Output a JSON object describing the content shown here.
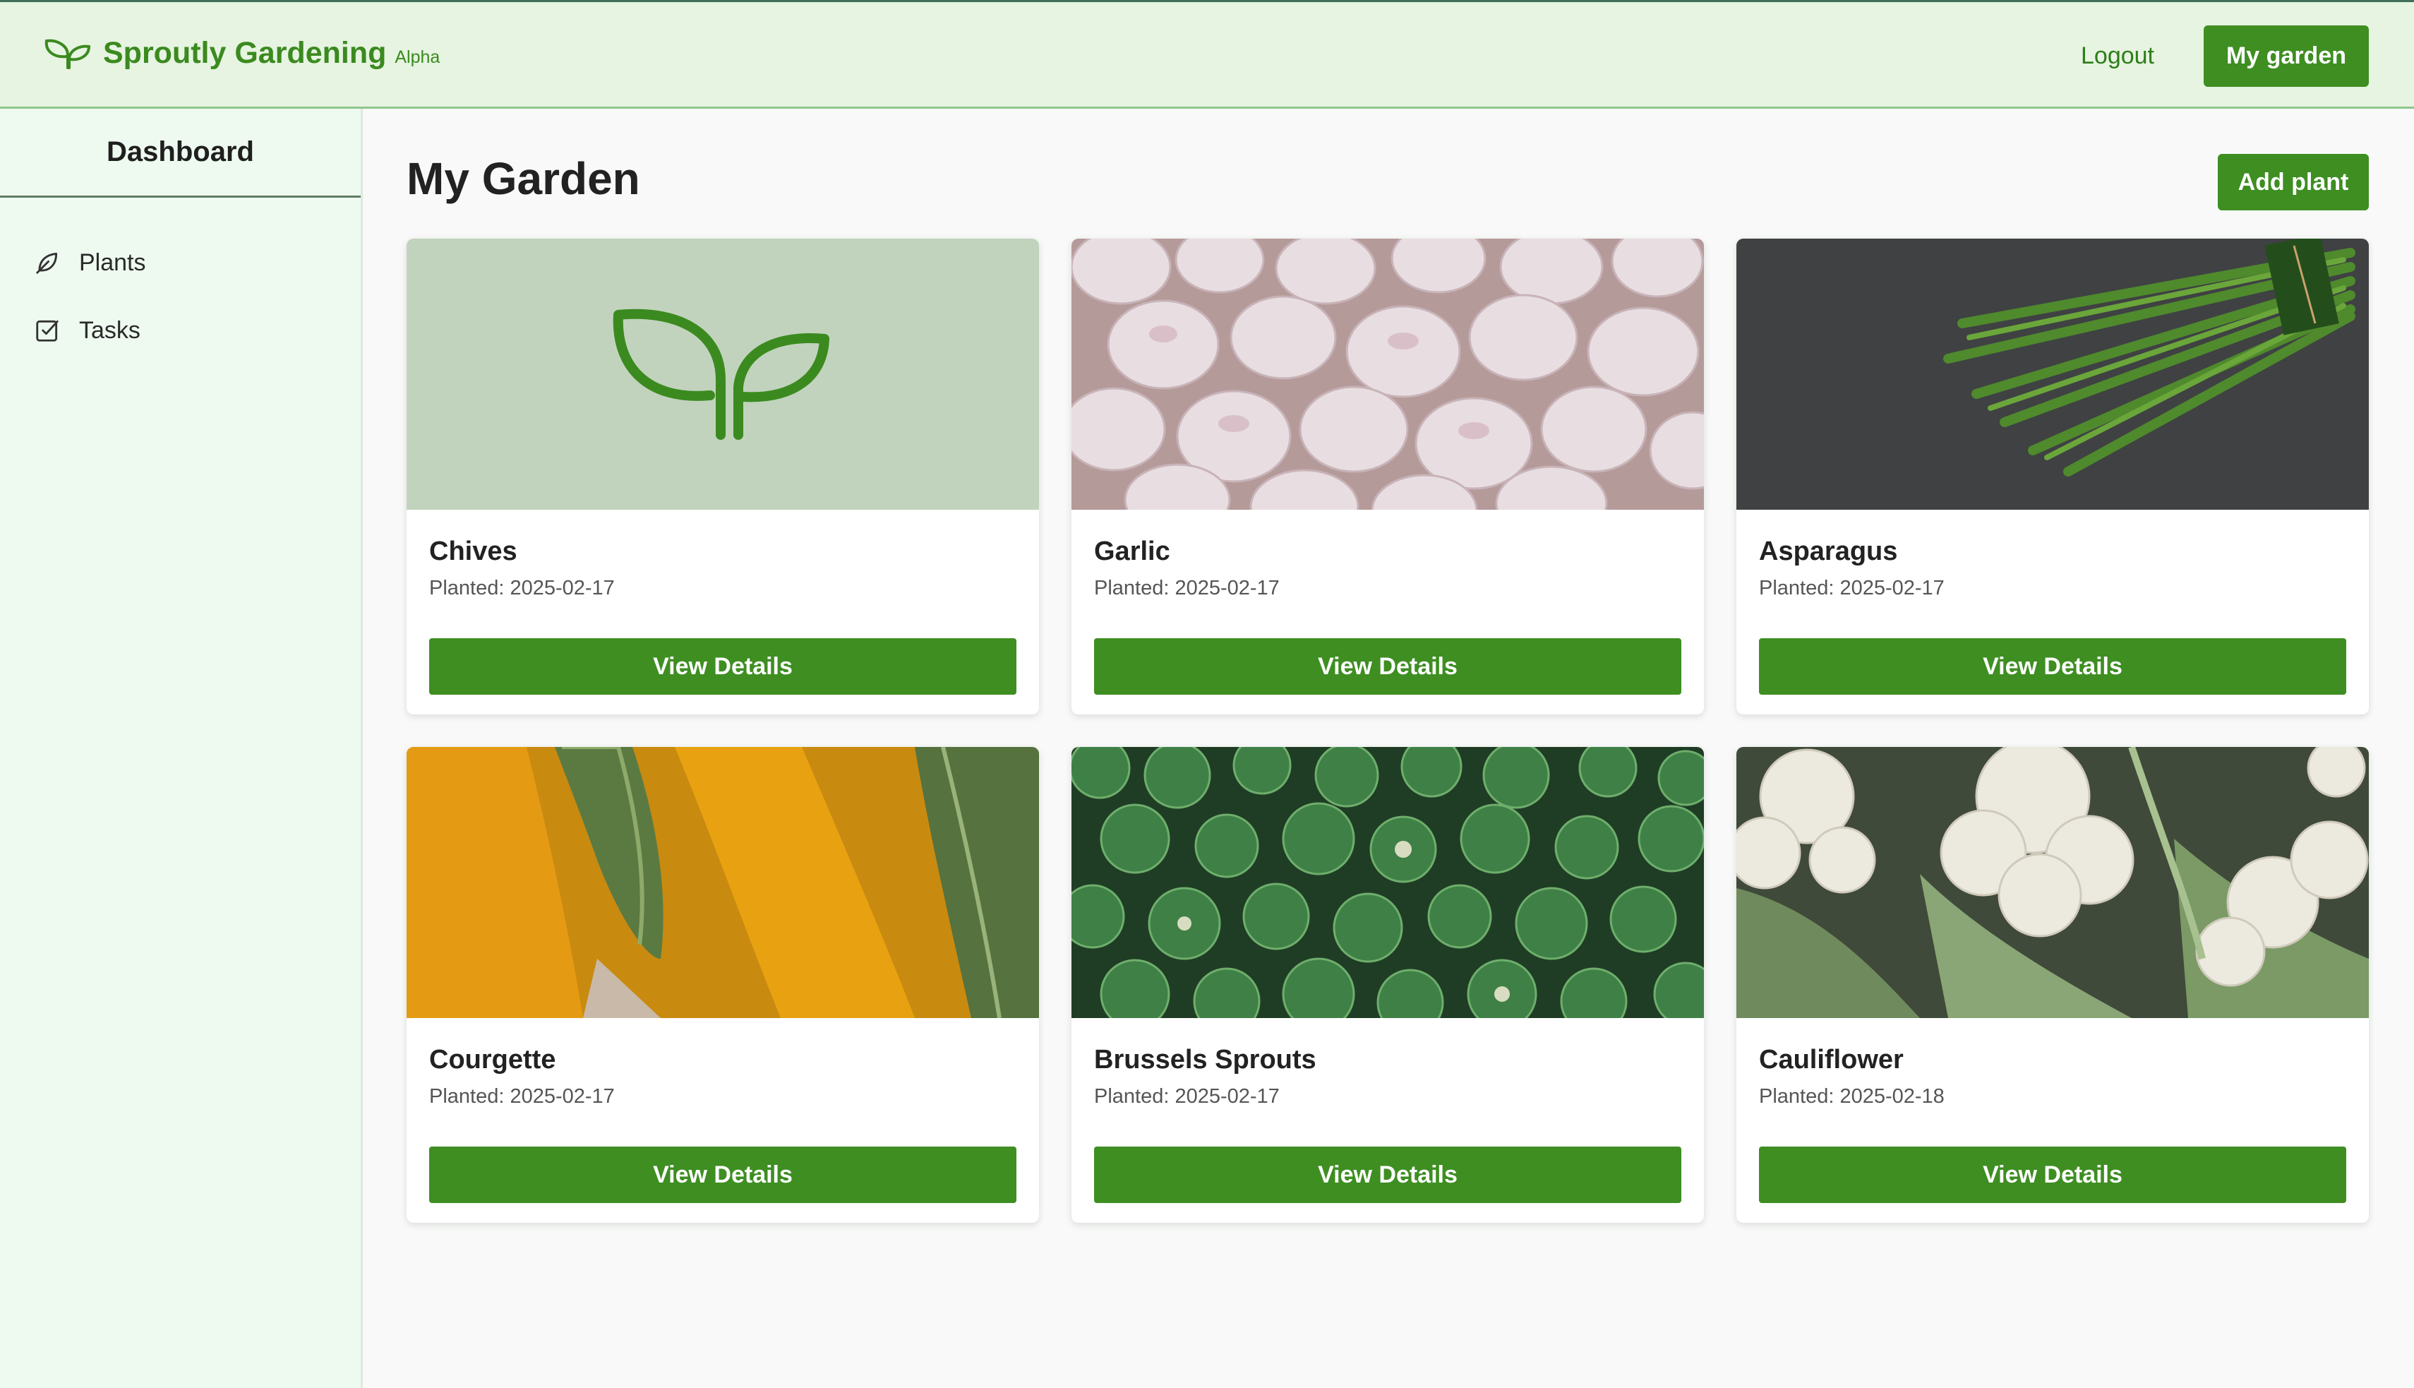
{
  "header": {
    "brand_name": "Sproutly Gardening",
    "brand_badge": "Alpha",
    "brand_icon": "sprout-icon",
    "logout_label": "Logout",
    "my_garden_label": "My garden"
  },
  "sidebar": {
    "title": "Dashboard",
    "items": [
      {
        "label": "Plants",
        "icon": "leaf-icon"
      },
      {
        "label": "Tasks",
        "icon": "checkbox-icon"
      }
    ]
  },
  "main": {
    "title": "My Garden",
    "add_plant_label": "Add plant",
    "view_details_label": "View Details",
    "cards": [
      {
        "name": "Chives",
        "planted": "Planted: 2025-02-17",
        "image": "placeholder-sprout"
      },
      {
        "name": "Garlic",
        "planted": "Planted: 2025-02-17",
        "image": "garlic-photo"
      },
      {
        "name": "Asparagus",
        "planted": "Planted: 2025-02-17",
        "image": "asparagus-photo"
      },
      {
        "name": "Courgette",
        "planted": "Planted: 2025-02-17",
        "image": "courgette-photo"
      },
      {
        "name": "Brussels Sprouts",
        "planted": "Planted: 2025-02-17",
        "image": "brussels-sprouts-photo"
      },
      {
        "name": "Cauliflower",
        "planted": "Planted: 2025-02-18",
        "image": "cauliflower-photo"
      }
    ]
  },
  "colors": {
    "primary": "#3e8e22",
    "header_bg": "#e6f4e1",
    "sidebar_bg": "#eefaf0",
    "page_bg": "#f8f9f8"
  }
}
